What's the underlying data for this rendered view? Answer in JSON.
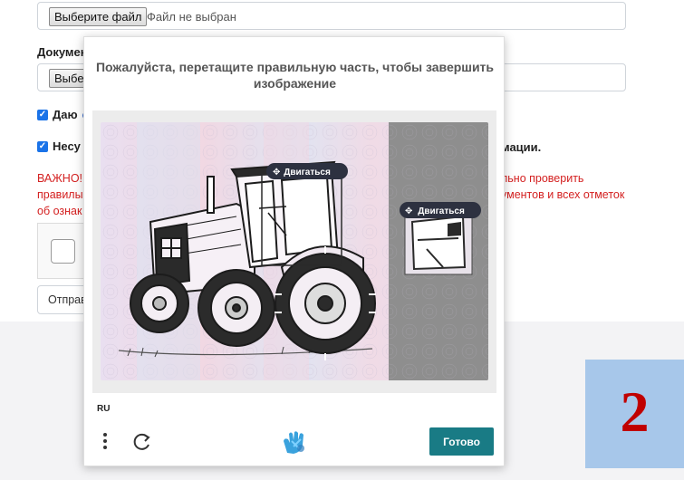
{
  "form": {
    "file_button": "Выберите файл",
    "file_status": "Файл не выбран",
    "doc_label": "Докумен",
    "file_button2": "Выбе",
    "consent1_prefix": "Даю",
    "consent1_link": "с",
    "consent2": "Несу",
    "consent2_end": "мации.",
    "warn_line1": "ВАЖНО!",
    "warn_line2": "правилы",
    "warn_line3": "об ознак",
    "warn_right1": "льно проверить",
    "warn_right2": "ументов и всех отметок",
    "submit_label": "Отправ"
  },
  "captcha": {
    "title": "Пожалуйста, перетащите правильную часть, чтобы завершить изображение",
    "move_label_main": "Двигаться",
    "move_label_piece": "Двигаться",
    "lang": "RU",
    "done_label": "Готово"
  },
  "overlay": {
    "number": "2",
    "box_color": "#a7c7ea",
    "number_color": "#c00000"
  },
  "colors": {
    "accent": "#197b85",
    "checkbox": "#1a73e8",
    "warning": "#d42020"
  }
}
